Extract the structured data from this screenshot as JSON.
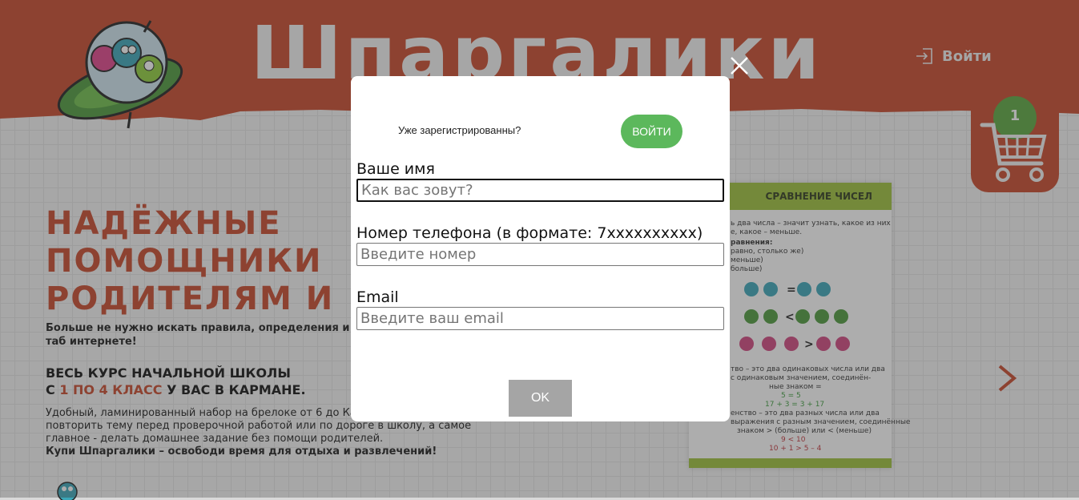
{
  "colors": {
    "brand_red": "#c9482a",
    "header_red": "#b23b22",
    "green": "#5cb85c",
    "ok_gray": "#a5a5a5"
  },
  "header": {
    "logo_text": "Шпаргалики",
    "login_label": "Войти",
    "login_icon": "login-icon",
    "cart_icon": "cart-icon",
    "cart_count": "1"
  },
  "hero": {
    "title_lines": [
      "НАДЁЖНЫЕ",
      "ПОМОЩНИКИ",
      "РОДИТЕЛЯМ И"
    ],
    "subtitle": "Больше не нужно искать правила, определения и таб интернете!",
    "course_line1": "ВЕСЬ КУРС НАЧАЛЬНОЙ ШКОЛЫ",
    "course_prefix": "С ",
    "course_highlight": "1 ПО 4 КЛАСС",
    "course_suffix": " У ВАС В КАРМАНЕ.",
    "desc": "Удобный, ламинированный набор на брелоке от 6 до Карточки можно взять с собой, повторить тему перед проверочной работой или по дороге в школу, а самое главное - делать домашнее задание без помощи родителей.",
    "desc_strong": "Купи Шпаргалики – освободи время для отдыха и развлечений!"
  },
  "card": {
    "title": "СРАВНЕНИЕ ЧИСЕЛ",
    "lines": [
      "ь два числа – значит узнать, какое из них",
      "е, какое – меньше.",
      "равнения:",
      "равно, столько же)",
      "меньше)",
      "больше)"
    ],
    "eq_sign": "=",
    "lt_sign": "<",
    "gt_sign": ">",
    "equality_text": "тво – это два одинаковых числа или два",
    "equality_text2": "с одинаковым значением, соединён-",
    "equality_text3": "ные знаком =",
    "eq_example1": "5 = 5",
    "eq_example2": "17 + 3 = 3 + 17",
    "inequality_text": "енство – это два разных числа или два",
    "inequality_text2": "выражения с разным значением, соединённые",
    "inequality_text3": "знаком > (больше) или < (меньше)",
    "ineq_example1": "9 < 10",
    "ineq_example2": "10 + 1 > 5 – 4"
  },
  "modal": {
    "close_icon": "close-icon",
    "registered_text": "Уже зарегистрированны?",
    "login_button": "ВОЙТИ",
    "name_label": "Ваше имя",
    "name_placeholder": "Как вас зовут?",
    "phone_label": "Номер телефона (в формате: 7xxxxxxxxxx)",
    "phone_placeholder": "Введите номер",
    "email_label": "Email",
    "email_placeholder": "Введите ваш email",
    "ok_button": "OK"
  }
}
